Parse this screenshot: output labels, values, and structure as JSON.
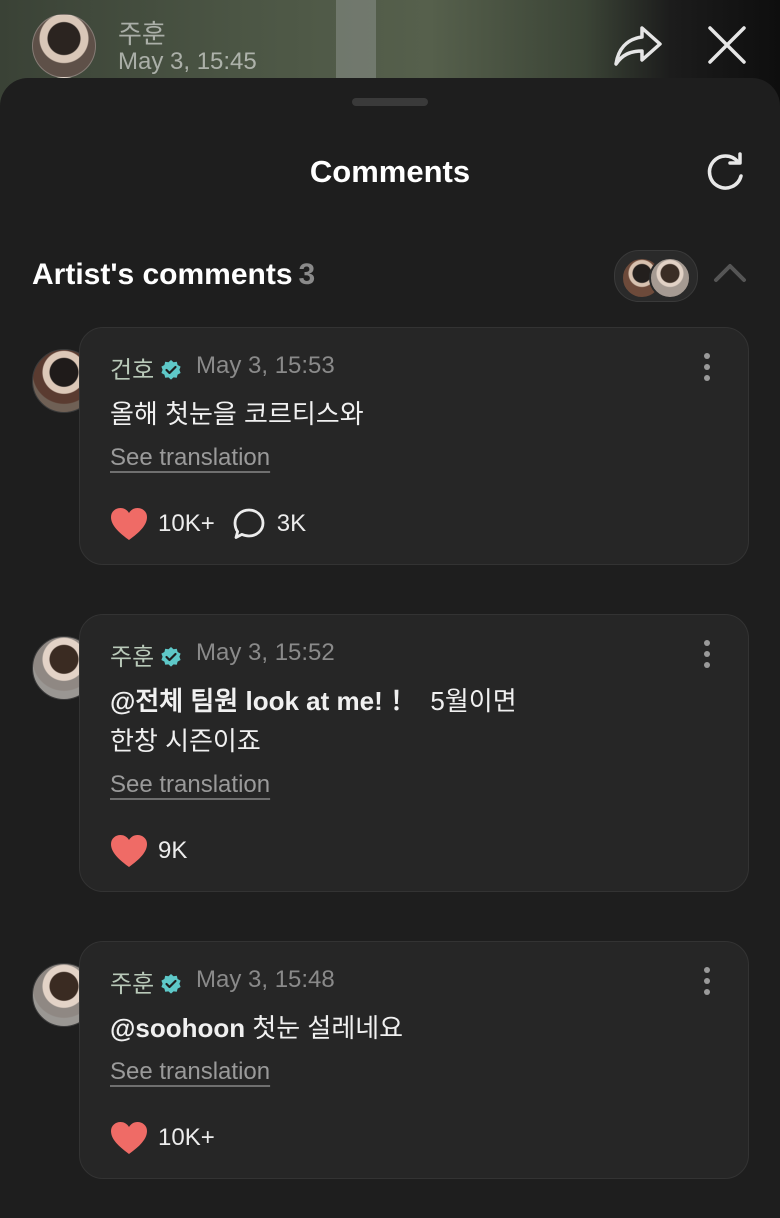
{
  "post": {
    "author": "주훈",
    "date": "May 3, 15:45"
  },
  "sheet": {
    "title": "Comments"
  },
  "section": {
    "title": "Artist's comments",
    "count": "3"
  },
  "comments": [
    {
      "author": "건호",
      "date": "May 3, 15:53",
      "text": "올해 첫눈을 코르티스와",
      "mention": "",
      "text_line2": "",
      "see_translation": "See translation",
      "likes": "10K+",
      "replies": "3K"
    },
    {
      "author": "주훈",
      "date": "May 3, 15:52",
      "mention": "@전체 팀원 look at me! ！",
      "text": "5월이면",
      "text_line2": "한창 시즌이죠",
      "see_translation": "See translation",
      "likes": "9K",
      "replies": ""
    },
    {
      "author": "주훈",
      "date": "May 3, 15:48",
      "mention": "@soohoon",
      "text": "첫눈 설레네요",
      "text_line2": "",
      "see_translation": "See translation",
      "likes": "10K+",
      "replies": ""
    }
  ],
  "colors": {
    "heart": "#ef6b66",
    "verified": "#5ec8c8",
    "background": "#1e1e1e",
    "card": "#262626"
  },
  "icons": [
    "share-icon",
    "close-icon",
    "refresh-icon",
    "chevron-up-icon",
    "verified-badge-icon",
    "more-vertical-icon",
    "heart-icon",
    "comment-bubble-icon"
  ]
}
